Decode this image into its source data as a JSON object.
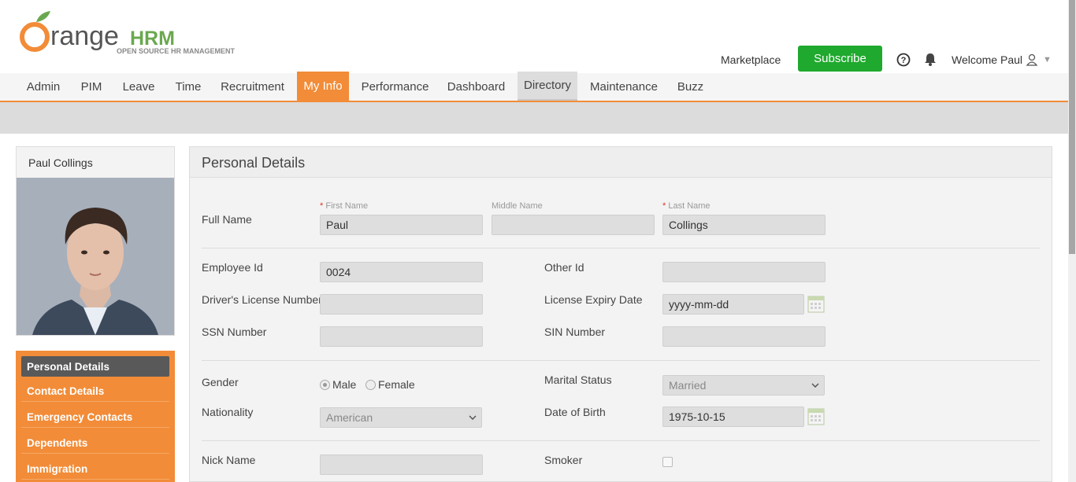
{
  "brand": {
    "logo_main": "range",
    "logo_o": "O",
    "logo_hrm": "HRM",
    "tagline": "OPEN SOURCE HR MANAGEMENT"
  },
  "header": {
    "marketplace": "Marketplace",
    "subscribe": "Subscribe",
    "welcome": "Welcome Paul"
  },
  "nav": {
    "items": [
      "Admin",
      "PIM",
      "Leave",
      "Time",
      "Recruitment",
      "My Info",
      "Performance",
      "Dashboard",
      "Directory",
      "Maintenance",
      "Buzz"
    ],
    "active": "My Info"
  },
  "profile": {
    "name": "Paul Collings"
  },
  "side_menu": {
    "items": [
      "Personal Details",
      "Contact Details",
      "Emergency Contacts",
      "Dependents",
      "Immigration"
    ],
    "active": "Personal Details"
  },
  "panel": {
    "title": "Personal Details",
    "full_name_label": "Full Name",
    "first_name_label": "First Name",
    "middle_name_label": "Middle Name",
    "last_name_label": "Last Name",
    "required_mark": "*",
    "first_name": "Paul",
    "middle_name": "",
    "last_name": "Collings",
    "employee_id_label": "Employee Id",
    "employee_id": "0024",
    "other_id_label": "Other Id",
    "other_id": "",
    "license_label": "Driver's License Number",
    "license": "",
    "license_expiry_label": "License Expiry Date",
    "license_expiry": "yyyy-mm-dd",
    "ssn_label": "SSN Number",
    "ssn": "",
    "sin_label": "SIN Number",
    "sin": "",
    "gender_label": "Gender",
    "gender_options": [
      "Male",
      "Female"
    ],
    "gender_selected": "Male",
    "marital_label": "Marital Status",
    "marital": "Married",
    "nationality_label": "Nationality",
    "nationality": "American",
    "dob_label": "Date of Birth",
    "dob": "1975-10-15",
    "nick_label": "Nick Name",
    "nick": "",
    "smoker_label": "Smoker",
    "smoker_checked": false
  },
  "colors": {
    "accent": "#f28c38",
    "subscribe": "#1fa92e",
    "active_side": "#595959"
  }
}
